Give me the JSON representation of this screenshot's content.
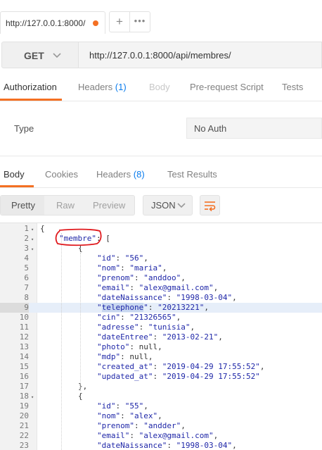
{
  "tab": {
    "url": "http://127.0.0.1:8000/",
    "plus": "+",
    "more": "•••"
  },
  "request": {
    "method": "GET",
    "url": "http://127.0.0.1:8000/api/membres/"
  },
  "request_tabs": [
    {
      "label": "Authorization",
      "count": ""
    },
    {
      "label": "Headers",
      "count": "(1)"
    },
    {
      "label": "Body",
      "count": ""
    },
    {
      "label": "Pre-request Script",
      "count": ""
    },
    {
      "label": "Tests",
      "count": ""
    }
  ],
  "auth": {
    "type_label": "Type",
    "type_value": "No Auth"
  },
  "response_tabs": [
    {
      "label": "Body",
      "count": ""
    },
    {
      "label": "Cookies",
      "count": ""
    },
    {
      "label": "Headers",
      "count": "(8)"
    },
    {
      "label": "Test Results",
      "count": ""
    }
  ],
  "view": {
    "pretty": "Pretty",
    "raw": "Raw",
    "preview": "Preview",
    "format": "JSON"
  },
  "code": {
    "line_numbers": [
      "1",
      "2",
      "3",
      "4",
      "5",
      "6",
      "7",
      "8",
      "9",
      "10",
      "11",
      "12",
      "13",
      "14",
      "15",
      "16",
      "17",
      "18",
      "19",
      "20",
      "21",
      "22",
      "23"
    ],
    "open_brace": "{",
    "membre_key": "\"membre\"",
    "open_bracket": "[",
    "obj_open": "{",
    "obj_close": "},",
    "record1": [
      {
        "k": "\"id\"",
        "v": "\"56\""
      },
      {
        "k": "\"nom\"",
        "v": "\"maria\""
      },
      {
        "k": "\"prenom\"",
        "v": "\"anddoo\""
      },
      {
        "k": "\"email\"",
        "v": "\"alex@gmail.com\""
      },
      {
        "k": "\"dateNaissance\"",
        "v": "\"1998-03-04\""
      },
      {
        "k": "\"telephone\"",
        "v": "\"20213221\""
      },
      {
        "k": "\"cin\"",
        "v": "\"21326565\""
      },
      {
        "k": "\"adresse\"",
        "v": "\"tunisia\""
      },
      {
        "k": "\"dateEntree\"",
        "v": "\"2013-02-21\""
      },
      {
        "k": "\"photo\"",
        "v": "null"
      },
      {
        "k": "\"mdp\"",
        "v": "null"
      },
      {
        "k": "\"created_at\"",
        "v": "\"2019-04-29 17:55:52\""
      },
      {
        "k": "\"updated_at\"",
        "v": "\"2019-04-29 17:55:52\""
      }
    ],
    "record2": [
      {
        "k": "\"id\"",
        "v": "\"55\""
      },
      {
        "k": "\"nom\"",
        "v": "\"alex\""
      },
      {
        "k": "\"prenom\"",
        "v": "\"andder\""
      },
      {
        "k": "\"email\"",
        "v": "\"alex@gmail.com\""
      },
      {
        "k": "\"dateNaissance\"",
        "v": "\"1998-03-04\""
      }
    ]
  },
  "colors": {
    "accent": "#f47023",
    "count": "#097bed",
    "json_string": "#1f27a8",
    "annotation": "#e0191d"
  }
}
